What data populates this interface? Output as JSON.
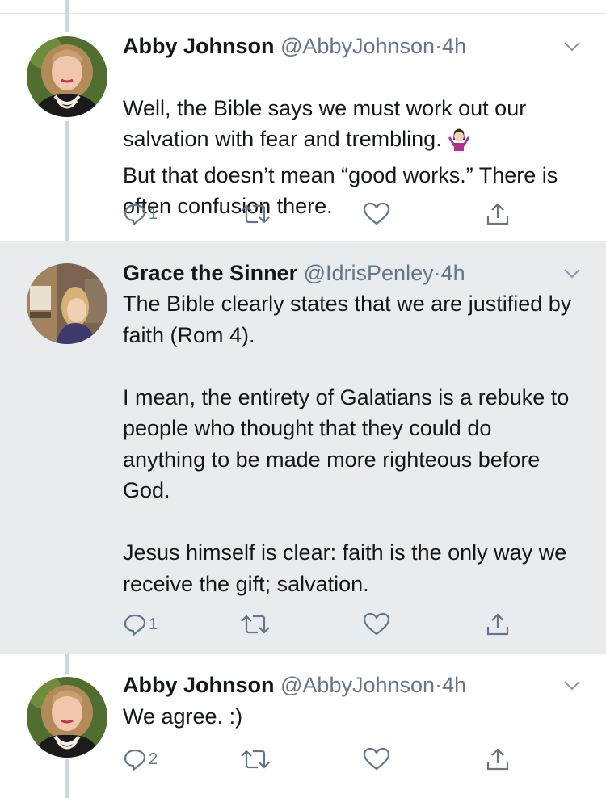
{
  "tweets": [
    {
      "name": "Abby Johnson",
      "handle": "@AbbyJohnson",
      "dot": "·",
      "time": "4h",
      "text": "Well, the Bible says we must work out our salvation with fear and trembling.",
      "text_after_emoji": "But that doesn’t mean “good works.” There is often confusion there.",
      "emoji": "woman-shrugging-emoji",
      "reply_count": "1",
      "avatar": "avatar-abby-johnson"
    },
    {
      "name": "Grace the Sinner",
      "handle": "@IdrisPenley",
      "dot": "·",
      "time": "4h",
      "text": "The Bible clearly states that we are justified by faith (Rom 4).\n\nI mean, the entirety of Galatians is a rebuke to people who thought that they could do anything to be made more righteous before God.\n\nJesus himself is clear: faith is the only way we receive the gift; salvation.",
      "reply_count": "1",
      "avatar": "avatar-grace-the-sinner"
    },
    {
      "name": "Abby Johnson",
      "handle": "@AbbyJohnson",
      "dot": "·",
      "time": "4h",
      "text": "We agree. :)",
      "reply_count": "2",
      "avatar": "avatar-abby-johnson"
    }
  ],
  "icons": [
    "reply-icon",
    "retweet-icon",
    "like-icon",
    "share-icon",
    "chevron-down-icon"
  ],
  "colors": {
    "text": "#14171a",
    "secondary": "#657786",
    "thread_line": "#ccd6dd",
    "highlight_bg": "#e9ecef"
  }
}
